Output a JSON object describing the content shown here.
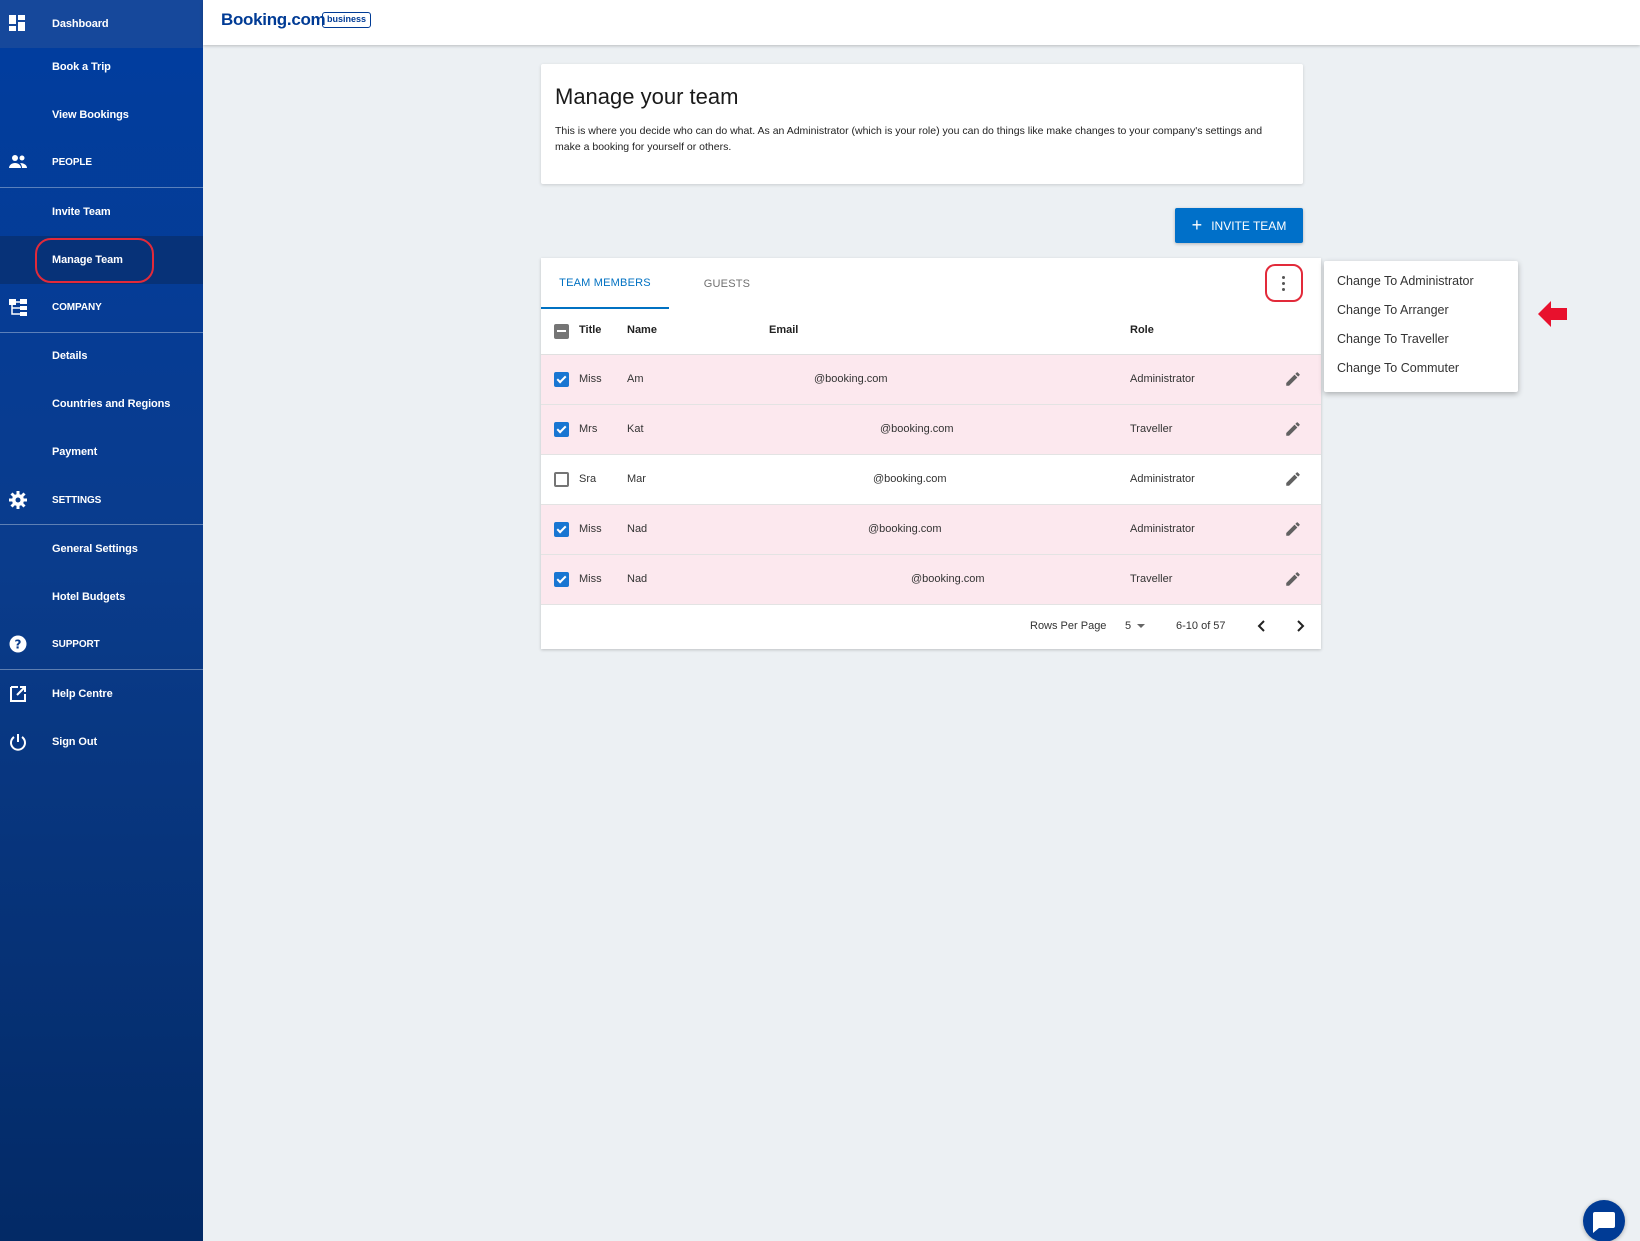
{
  "sidebar": {
    "items": [
      {
        "label": "Dashboard",
        "icon": "dashboard-icon"
      },
      {
        "label": "Book a Trip"
      },
      {
        "label": "View Bookings"
      },
      {
        "label": "PEOPLE",
        "icon": "people-icon"
      },
      {
        "label": "Invite Team"
      },
      {
        "label": "Manage Team"
      },
      {
        "label": "COMPANY",
        "icon": "company-icon"
      },
      {
        "label": "Details"
      },
      {
        "label": "Countries and Regions"
      },
      {
        "label": "Payment"
      },
      {
        "label": "SETTINGS",
        "icon": "settings-icon"
      },
      {
        "label": "General Settings"
      },
      {
        "label": "Hotel Budgets"
      },
      {
        "label": "SUPPORT",
        "icon": "help-icon"
      },
      {
        "label": "Help Centre",
        "icon": "external-link-icon"
      },
      {
        "label": "Sign Out",
        "icon": "power-icon"
      }
    ],
    "active_item": "Manage Team"
  },
  "header": {
    "logo_text": "Booking.com",
    "logo_badge": "business"
  },
  "intro": {
    "title": "Manage your team",
    "description": "This is where you decide who can do what. As an Administrator (which is your role) you can do things like make changes to your company's settings and make a booking for yourself or others."
  },
  "invite_button": {
    "label": "INVITE TEAM"
  },
  "tabs": [
    {
      "label": "TEAM MEMBERS",
      "active": true
    },
    {
      "label": "GUESTS",
      "active": false
    }
  ],
  "table": {
    "columns": [
      "Title",
      "Name",
      "Email",
      "Role"
    ],
    "rows": [
      {
        "selected": true,
        "title": "Miss",
        "name": "Am",
        "email": "@booking.com",
        "role": "Administrator"
      },
      {
        "selected": true,
        "title": "Mrs",
        "name": "Kat",
        "email": "@booking.com",
        "role": "Traveller"
      },
      {
        "selected": false,
        "title": "Sra",
        "name": "Mar",
        "email": "@booking.com",
        "role": "Administrator"
      },
      {
        "selected": true,
        "title": "Miss",
        "name": "Nad",
        "email": "@booking.com",
        "role": "Administrator"
      },
      {
        "selected": true,
        "title": "Miss",
        "name": "Nad",
        "email": "@booking.com",
        "role": "Traveller"
      }
    ]
  },
  "pagination": {
    "rows_per_page_label": "Rows Per Page",
    "rows_per_page_value": "5",
    "range": "6-10 of 57"
  },
  "menu": {
    "items": [
      "Change To Administrator",
      "Change To Arranger",
      "Change To Traveller",
      "Change To Commuter"
    ]
  },
  "colors": {
    "sidebar": "#003da0",
    "accent": "#0071c2",
    "selected_row": "#fce8ee",
    "annotation": "#e22a3a"
  }
}
